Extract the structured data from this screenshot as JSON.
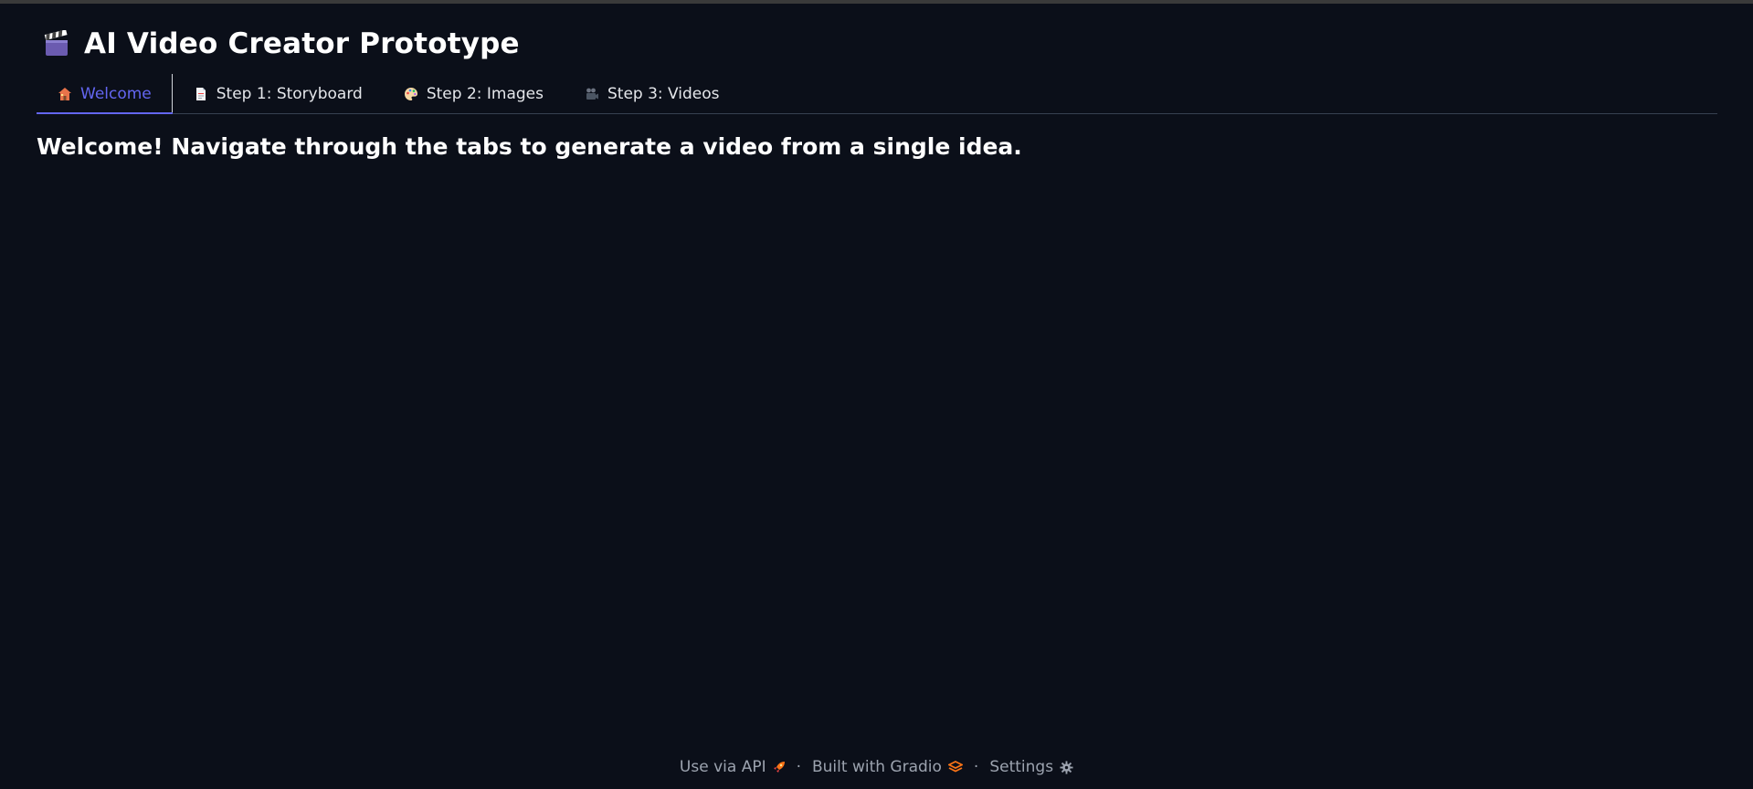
{
  "app": {
    "title": "AI Video Creator Prototype",
    "title_icon": "clapperboard-icon"
  },
  "tabs": [
    {
      "label": "Welcome",
      "icon": "house-icon",
      "active": true
    },
    {
      "label": "Step 1: Storyboard",
      "icon": "page-icon",
      "active": false
    },
    {
      "label": "Step 2: Images",
      "icon": "palette-icon",
      "active": false
    },
    {
      "label": "Step 3: Videos",
      "icon": "video-camera-icon",
      "active": false
    }
  ],
  "main": {
    "welcome_text": "Welcome! Navigate through the tabs to generate a video from a single idea."
  },
  "footer": {
    "api_label": "Use via API",
    "api_icon": "rocket-icon",
    "separator": "·",
    "built_label": "Built with Gradio",
    "built_icon": "gradio-logo-icon",
    "settings_label": "Settings",
    "settings_icon": "gear-icon"
  },
  "colors": {
    "background": "#0b0f19",
    "accent": "#6366f1",
    "text": "#ffffff",
    "muted": "#9ca3af"
  }
}
